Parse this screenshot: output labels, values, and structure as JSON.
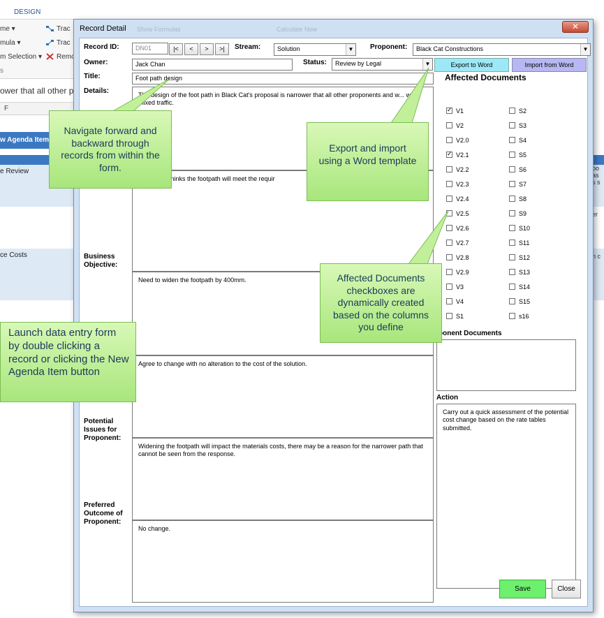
{
  "background": {
    "ribbon_tab": "DESIGN",
    "ribbon_items_left": [
      "me ▾",
      "mula ▾",
      "m Selection ▾",
      "s"
    ],
    "ribbon_items_right": [
      "Trac",
      "Trac",
      "Remo"
    ],
    "formula_text": "ower that all other p",
    "column_header": "F",
    "agenda_button": "w Agenda Item",
    "rows": [
      "e Review",
      "",
      "ce Costs"
    ],
    "right_fragments": [
      "bo",
      "as",
      "s s",
      "er",
      "n c"
    ]
  },
  "dialog": {
    "title": "Record Detail",
    "ghost_toolbar": [
      "Show Formulas",
      "Calculate Now"
    ],
    "close_symbol": "✕"
  },
  "form": {
    "labels": {
      "record_id": "Record ID:",
      "owner": "Owner:",
      "title": "Title:",
      "details": "Details:",
      "stream": "Stream:",
      "proponent": "Proponent:",
      "status": "Status:",
      "business_objective": "Business Objective:",
      "potential_issues": "Potential Issues for Proponent:",
      "preferred_outcome": "Preferred Outcome of Proponent:",
      "affected_documents": "Affected Documents",
      "proponent_documents": "ponent Documents",
      "action": "Action"
    },
    "record_id": "DN01",
    "nav_buttons": [
      "|<",
      "<",
      ">",
      ">|"
    ],
    "stream": "Solution",
    "proponent": "Black Cat Constructions",
    "owner": "Jack Chan",
    "status": "Review by Legal",
    "title": "Foot path design",
    "details_text": "The design of the foot path in Black Cat's proposal is narrower that all other proponents and w... w mixed traffic.",
    "details_text_2": "Proponent thinks the footpath will meet the requir",
    "business_objective_text": "Need to widen the footpath by 400mm.",
    "response_text": "Agree to change with no alteration to the cost of the solution.",
    "potential_issues_text": "Widening the footpath will impact the materials costs, there may be a reason for the narrower path that cannot be seen from the response.",
    "preferred_outcome_text": "No change.",
    "action_text": "Carry out a quick assessment of the potential cost change based on the rate tables submitted.",
    "export_label": "Export to Word",
    "import_label": "Import from Word",
    "save_label": "Save",
    "close_label": "Close",
    "documents_left": [
      {
        "label": "V1",
        "checked": true
      },
      {
        "label": "V2",
        "checked": false
      },
      {
        "label": "V2.0",
        "checked": false
      },
      {
        "label": "V2.1",
        "checked": true
      },
      {
        "label": "V2.2",
        "checked": false
      },
      {
        "label": "V2.3",
        "checked": false
      },
      {
        "label": "V2.4",
        "checked": false
      },
      {
        "label": "V2.5",
        "checked": false
      },
      {
        "label": "V2.6",
        "checked": false
      },
      {
        "label": "V2.7",
        "checked": false
      },
      {
        "label": "V2.8",
        "checked": false
      },
      {
        "label": "V2.9",
        "checked": false
      },
      {
        "label": "V3",
        "checked": false
      },
      {
        "label": "V4",
        "checked": false
      },
      {
        "label": "S1",
        "checked": false
      }
    ],
    "documents_right": [
      {
        "label": "S2",
        "checked": false
      },
      {
        "label": "S3",
        "checked": false
      },
      {
        "label": "S4",
        "checked": false
      },
      {
        "label": "S5",
        "checked": false
      },
      {
        "label": "S6",
        "checked": false
      },
      {
        "label": "S7",
        "checked": false
      },
      {
        "label": "S8",
        "checked": false
      },
      {
        "label": "S9",
        "checked": false
      },
      {
        "label": "S10",
        "checked": false
      },
      {
        "label": "S11",
        "checked": false
      },
      {
        "label": "S12",
        "checked": false
      },
      {
        "label": "S13",
        "checked": false
      },
      {
        "label": "S14",
        "checked": false
      },
      {
        "label": "S15",
        "checked": false
      },
      {
        "label": "s16",
        "checked": false
      }
    ]
  },
  "callouts": {
    "navigate": "Navigate forward and backward through records from within the form.",
    "export": "Export and import using a Word template",
    "affected": "Affected Documents checkboxes are dynamically created based on the columns you define",
    "launch": "Launch data entry form by double clicking a record or clicking the New Agenda Item button"
  }
}
